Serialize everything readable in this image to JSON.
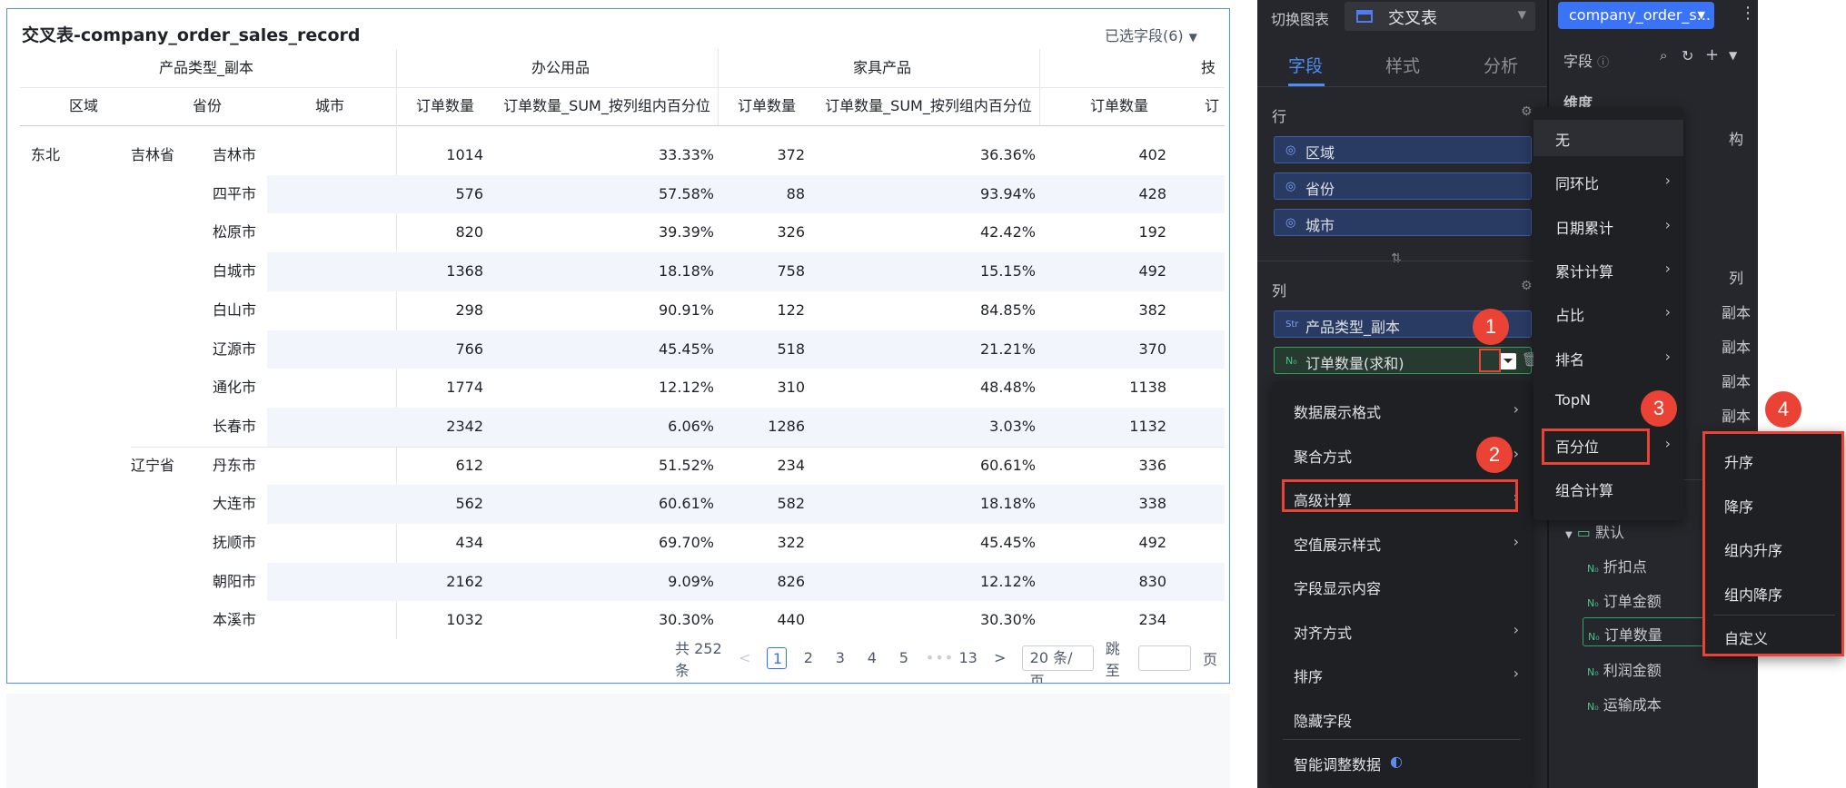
{
  "crosstab": {
    "title": "交叉表-company_order_sales_record",
    "field_picker": "已选字段(6)",
    "header_group_label": "产品类型_副本",
    "col_groups": [
      "办公用品",
      "家具产品",
      "技"
    ],
    "dim_headers": [
      "区域",
      "省份",
      "城市"
    ],
    "measure_headers": [
      "订单数量",
      "订单数量_SUM_按列组内百分位",
      "订单数量",
      "订单数量_SUM_按列组内百分位",
      "订单数量",
      "订"
    ],
    "rows": [
      {
        "region": "东北",
        "province": "吉林省",
        "city": "吉林市",
        "v": [
          "1014",
          "33.33%",
          "372",
          "36.36%",
          "402"
        ]
      },
      {
        "region": "",
        "province": "",
        "city": "四平市",
        "v": [
          "576",
          "57.58%",
          "88",
          "93.94%",
          "428"
        ]
      },
      {
        "region": "",
        "province": "",
        "city": "松原市",
        "v": [
          "820",
          "39.39%",
          "326",
          "42.42%",
          "192"
        ]
      },
      {
        "region": "",
        "province": "",
        "city": "白城市",
        "v": [
          "1368",
          "18.18%",
          "758",
          "15.15%",
          "492"
        ]
      },
      {
        "region": "",
        "province": "",
        "city": "白山市",
        "v": [
          "298",
          "90.91%",
          "122",
          "84.85%",
          "382"
        ]
      },
      {
        "region": "",
        "province": "",
        "city": "辽源市",
        "v": [
          "766",
          "45.45%",
          "518",
          "21.21%",
          "370"
        ]
      },
      {
        "region": "",
        "province": "",
        "city": "通化市",
        "v": [
          "1774",
          "12.12%",
          "310",
          "48.48%",
          "1138"
        ]
      },
      {
        "region": "",
        "province": "",
        "city": "长春市",
        "v": [
          "2342",
          "6.06%",
          "1286",
          "3.03%",
          "1132"
        ]
      },
      {
        "region": "",
        "province": "辽宁省",
        "city": "丹东市",
        "v": [
          "612",
          "51.52%",
          "234",
          "60.61%",
          "336"
        ]
      },
      {
        "region": "",
        "province": "",
        "city": "大连市",
        "v": [
          "562",
          "60.61%",
          "582",
          "18.18%",
          "338"
        ]
      },
      {
        "region": "",
        "province": "",
        "city": "抚顺市",
        "v": [
          "434",
          "69.70%",
          "322",
          "45.45%",
          "492"
        ]
      },
      {
        "region": "",
        "province": "",
        "city": "朝阳市",
        "v": [
          "2162",
          "9.09%",
          "826",
          "12.12%",
          "830"
        ]
      },
      {
        "region": "",
        "province": "",
        "city": "本溪市",
        "v": [
          "1032",
          "30.30%",
          "440",
          "30.30%",
          "234"
        ]
      }
    ],
    "pager": {
      "total": "共 252 条",
      "prev": "<",
      "pages": [
        "1",
        "2",
        "3",
        "4",
        "5"
      ],
      "ellipsis": "•••",
      "last": "13",
      "next": ">",
      "page_size": "20 条/页",
      "jump_label": "跳至",
      "page_suffix": "页"
    }
  },
  "config_panel": {
    "chart_switch_label": "切换图表",
    "chart_type": "交叉表",
    "tabs": [
      "字段",
      "样式",
      "分析"
    ],
    "row_section": "行",
    "row_fields": [
      "区域",
      "省份",
      "城市"
    ],
    "col_section": "列",
    "col_fields": [
      {
        "icon": "Str",
        "label": "产品类型_副本"
      },
      {
        "icon": "N₀",
        "label": "订单数量(求和)"
      }
    ]
  },
  "field_menu": {
    "items": [
      "数据展示格式",
      "聚合方式",
      "高级计算",
      "空值展示样式",
      "字段显示内容",
      "对齐方式",
      "排序",
      "隐藏字段",
      "智能调整数据"
    ]
  },
  "advanced_menu": {
    "items": [
      "无",
      "同环比",
      "日期累计",
      "累计计算",
      "占比",
      "排名",
      "TopN",
      "百分位",
      "组合计算"
    ]
  },
  "percentile_menu": {
    "items": [
      "升序",
      "降序",
      "组内升序",
      "组内降序",
      "自定义"
    ]
  },
  "badges": [
    "1",
    "2",
    "3",
    "4"
  ],
  "dataset_panel": {
    "dataset_name": "company_order_s...",
    "field_label": "字段",
    "dimension_label": "维度",
    "partial_texts": [
      "构",
      "列",
      "副本",
      "副本",
      "副本",
      "副本",
      "本"
    ],
    "folder": "默认",
    "measures": [
      "折扣点",
      "订单金额",
      "订单数量",
      "利润金额",
      "运输成本"
    ]
  },
  "colors": {
    "accent": "#3370ff",
    "annotation_red": "#ea4335",
    "panel_bg": "#26272c",
    "row_band": "#f2f5fb"
  }
}
